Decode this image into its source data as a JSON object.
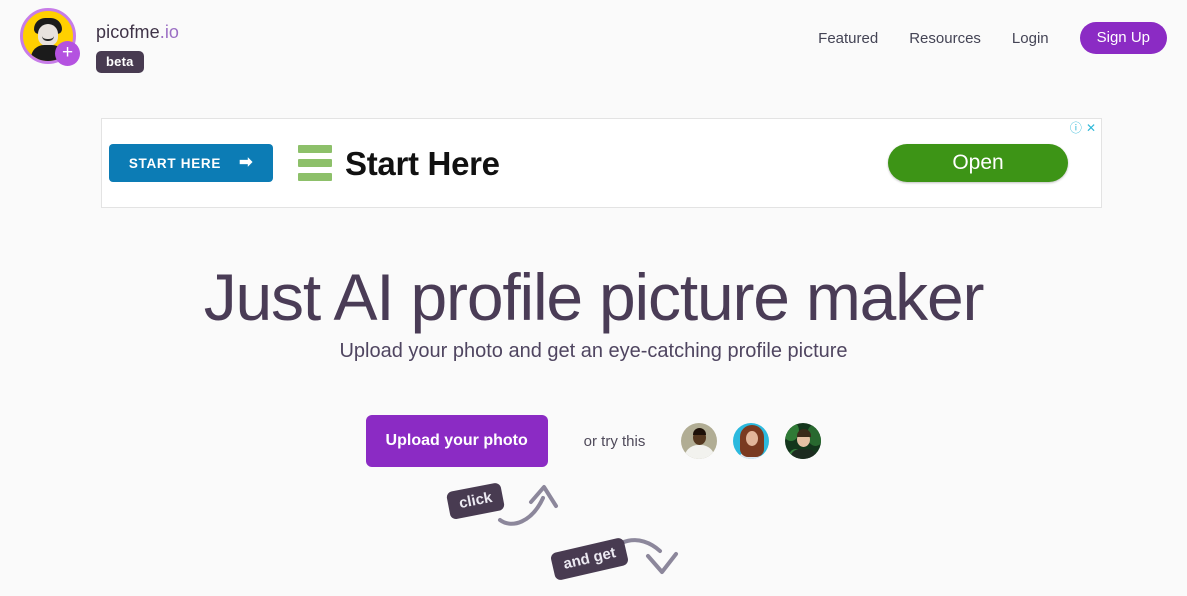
{
  "page": {
    "background_color": "#fafafa"
  },
  "header": {
    "logo": {
      "icon_name": "picofme-avatar-logo",
      "plus_glyph": "+",
      "ring_color": "#c77ce8",
      "background_color": "#ffd000"
    },
    "brand_name_main": "picofme",
    "brand_name_tld": ".io",
    "beta_label": "beta",
    "nav_links": [
      {
        "label": "Featured"
      },
      {
        "label": "Resources"
      },
      {
        "label": "Login"
      }
    ],
    "signup_label": "Sign Up",
    "signup_color": "#8b2bc4"
  },
  "ad": {
    "info_icon": "ⓘ",
    "close_icon": "✕",
    "icon_color": "#2fb8d8",
    "start_button_label": "START HERE",
    "start_button_arrow": "➡",
    "start_button_color": "#0c7cb5",
    "logo_icon_name": "three-green-bars-icon",
    "headline": "Start Here",
    "cta_label": "Open",
    "cta_color": "#3d9416"
  },
  "hero": {
    "title": "Just AI profile picture maker",
    "subtitle": "Upload your photo and get an eye-catching profile picture",
    "title_color": "#4a3c56"
  },
  "cta": {
    "upload_label": "Upload your photo",
    "upload_color": "#8b2bc4",
    "try_label": "or try this",
    "sample_avatars": [
      {
        "name": "sample-avatar-1"
      },
      {
        "name": "sample-avatar-2"
      },
      {
        "name": "sample-avatar-3"
      }
    ]
  },
  "annotations": [
    {
      "label": "click",
      "icon_name": "curved-arrow-up-icon"
    },
    {
      "label": "and get",
      "icon_name": "curved-arrow-down-icon"
    }
  ]
}
